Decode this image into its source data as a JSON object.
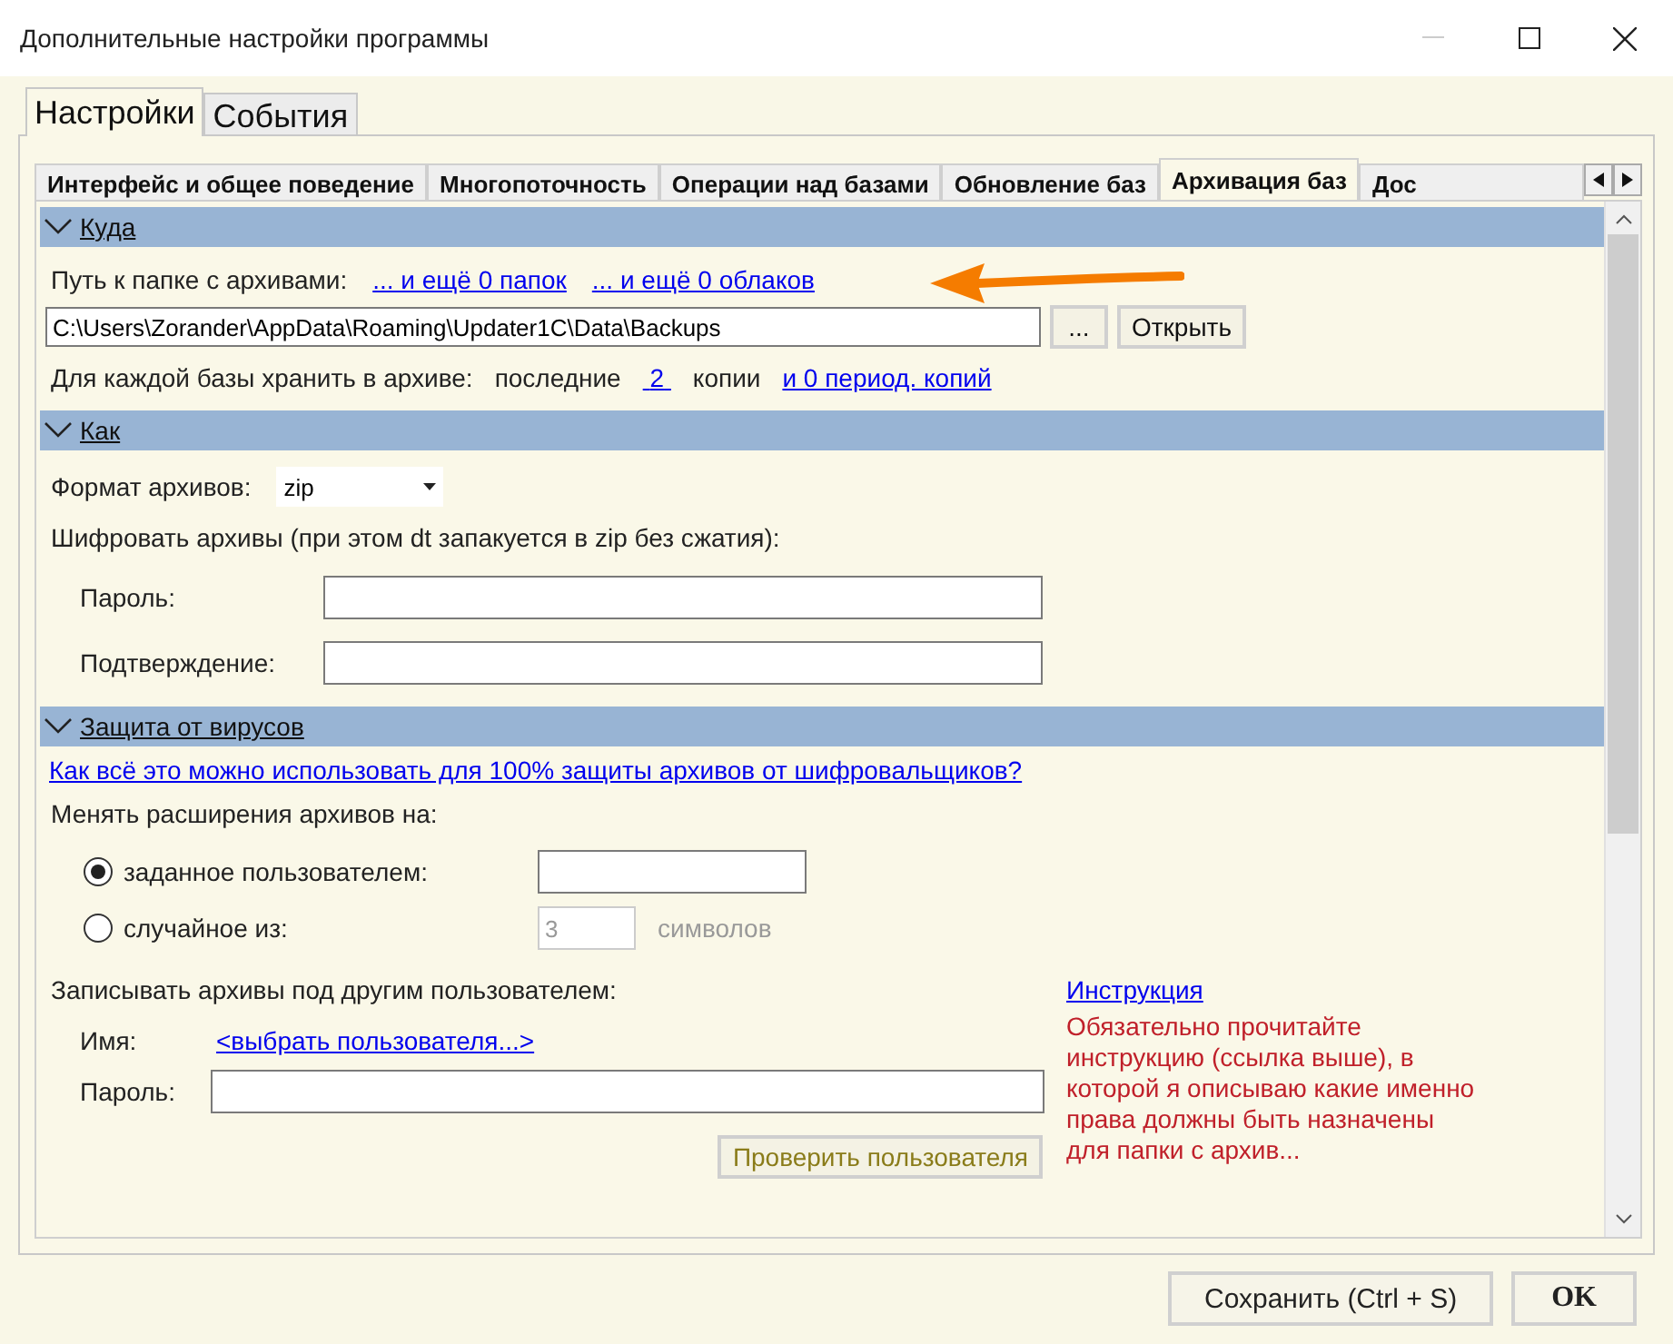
{
  "window": {
    "title": "Дополнительные настройки программы"
  },
  "main_tabs": [
    {
      "label": "Настройки",
      "selected": true
    },
    {
      "label": "События",
      "selected": false
    }
  ],
  "sub_tabs": [
    {
      "label": "Интерфейс и общее поведение",
      "selected": false
    },
    {
      "label": "Многопоточность",
      "selected": false
    },
    {
      "label": "Операции над базами",
      "selected": false
    },
    {
      "label": "Обновление баз",
      "selected": false
    },
    {
      "label": "Архивация баз",
      "selected": true
    },
    {
      "label": "Дос",
      "selected": false
    }
  ],
  "where": {
    "title": "Куда",
    "expanded": true,
    "path_label": "Путь к папке с архивами:",
    "folders_link": "... и ещё 0 папок",
    "clouds_link": "... и ещё 0 облаков",
    "path_value": "C:\\Users\\Zorander\\AppData\\Roaming\\Updater1C\\Data\\Backups",
    "browse_button": "...",
    "open_button": "Открыть",
    "keep_label": "Для каждой базы хранить в архиве:",
    "last_label": "последние",
    "copies_link": "2",
    "copies_label": "копии",
    "periodic_link": "и 0 период. копий"
  },
  "how": {
    "title": "Как",
    "expanded": true,
    "format_label": "Формат архивов:",
    "format_value": "zip",
    "encrypt_label": "Шифровать архивы (при этом dt запакуется в zip без сжатия):",
    "password_label": "Пароль:",
    "confirm_label": "Подтверждение:"
  },
  "antivirus": {
    "title": "Защита от вирусов",
    "expanded": true,
    "help_link": "Как всё это можно использовать для 100% защиты архивов от шифровальщиков?",
    "extension_label": "Менять расширения архивов на:",
    "options": [
      {
        "label": "заданное пользователем:",
        "selected": true,
        "disabled": false
      },
      {
        "label": "случайное из:",
        "selected": false,
        "disabled": true,
        "value": "3",
        "suffix": "символов"
      }
    ],
    "other_user_label": "Записывать архивы под другим пользователем:",
    "name_label": "Имя:",
    "user_link": "<выбрать пользователя...>",
    "password_label": "Пароль:",
    "check_button": {
      "label": "Проверить пользователя",
      "disabled": true
    },
    "instruction_link": "Инструкция",
    "warning": "Обязательно прочитайте инструкцию (ссылка выше), в которой я описываю какие именно права должны быть назначены для папки с архив..."
  },
  "buttons": [
    {
      "label": "Сохранить (Ctrl + S)",
      "default": false
    },
    {
      "label": "OK",
      "default": true
    }
  ]
}
